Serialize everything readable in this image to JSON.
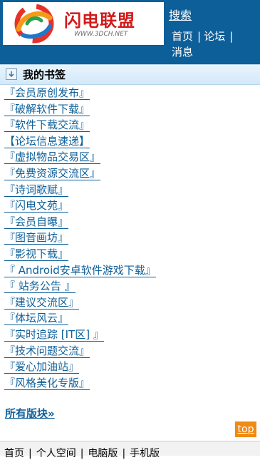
{
  "header": {
    "logo_title": "闪电联盟",
    "logo_subtitle": "WWW.3DCH.NET",
    "search_label": "搜索",
    "nav": [
      {
        "label": "首页"
      },
      {
        "label": "论坛"
      },
      {
        "label": "消息"
      }
    ],
    "nav_separator": "|"
  },
  "section": {
    "title": "我的书签"
  },
  "forums": [
    {
      "label": "『会员原创发布』"
    },
    {
      "label": "『破解软件下载』"
    },
    {
      "label": "『软件下载交流』"
    },
    {
      "label": "【论坛信息速递】"
    },
    {
      "label": "『虚拟物品交易区』"
    },
    {
      "label": "『免费资源交流区』"
    },
    {
      "label": "『诗词歌赋』"
    },
    {
      "label": "『闪电文苑』"
    },
    {
      "label": "『会员自曝』"
    },
    {
      "label": "『图音画坊』"
    },
    {
      "label": "『影视下载』"
    },
    {
      "label": "『 Android安卓软件游戏下载』"
    },
    {
      "label": "『 站务公告 』"
    },
    {
      "label": "『建议交流区』"
    },
    {
      "label": "『体坛风云』"
    },
    {
      "label": "『实时追踪 [IT区] 』"
    },
    {
      "label": "『技术问题交流』"
    },
    {
      "label": "『爱心加油站』"
    },
    {
      "label": "『风格美化专版』"
    }
  ],
  "all_boards_label": "所有版块»",
  "top_label": "top",
  "footer": {
    "links": [
      {
        "label": "首页"
      },
      {
        "label": "个人空间"
      },
      {
        "label": "电脑版"
      },
      {
        "label": "手机版"
      }
    ],
    "separator": "|"
  },
  "colors": {
    "header_bg": "#0d5f99",
    "link": "#0d5f99",
    "logo_red": "#d11a1a",
    "top_button": "#f08a12"
  },
  "icons": {
    "logo": "swirl-logo-icon",
    "section": "down-arrow-icon"
  }
}
